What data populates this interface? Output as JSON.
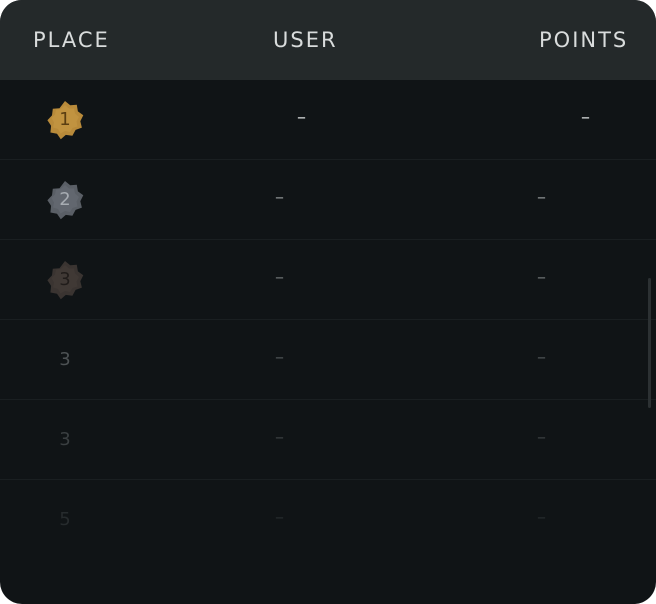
{
  "header": {
    "place_label": "PLACE",
    "user_label": "USER",
    "points_label": "POINTS"
  },
  "rows": [
    {
      "place": "1",
      "user": "–",
      "points": "–",
      "medal": "gold"
    },
    {
      "place": "2",
      "user": "–",
      "points": "–",
      "medal": "silver"
    },
    {
      "place": "3",
      "user": "–",
      "points": "–",
      "medal": "bronze"
    },
    {
      "place": "3",
      "user": "–",
      "points": "–"
    },
    {
      "place": "3",
      "user": "–",
      "points": "–"
    },
    {
      "place": "5",
      "user": "–",
      "points": "–"
    }
  ],
  "colors": {
    "panel_bg": "#101416",
    "header_bg": "#24292a",
    "gold": "#b88a3a",
    "silver": "#5a5f66",
    "bronze": "#3a3431"
  }
}
